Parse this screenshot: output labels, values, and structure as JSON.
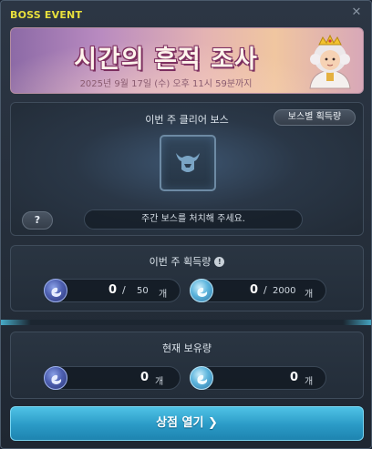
{
  "window": {
    "title": "BOSS EVENT",
    "close_icon": "close-icon"
  },
  "banner": {
    "title": "시간의 흔적 조사",
    "date": "2025년 9월 17일 (수) 오후 11시 59분까지"
  },
  "boss_panel": {
    "label": "이번 주 클리어 보스",
    "boss_gain_button": "보스별 획득량",
    "help_button": "?",
    "message": "주간 보스를 처치해 주세요."
  },
  "weekly": {
    "label": "이번 주 획득량",
    "info_icon": "!",
    "item1": {
      "value": "0",
      "separator": "/",
      "max": "50",
      "unit": "개"
    },
    "item2": {
      "value": "0",
      "separator": "/",
      "max": "2000",
      "unit": "개"
    }
  },
  "owned": {
    "label": "현재 보유량",
    "item1": {
      "value": "0",
      "unit": "개"
    },
    "item2": {
      "value": "0",
      "unit": "개"
    }
  },
  "shop_button": "상점 열기 ❯",
  "colors": {
    "title_yellow": "#e8e03c",
    "accent_cyan": "#2a9ac6",
    "banner_text": "#fff4ec"
  }
}
